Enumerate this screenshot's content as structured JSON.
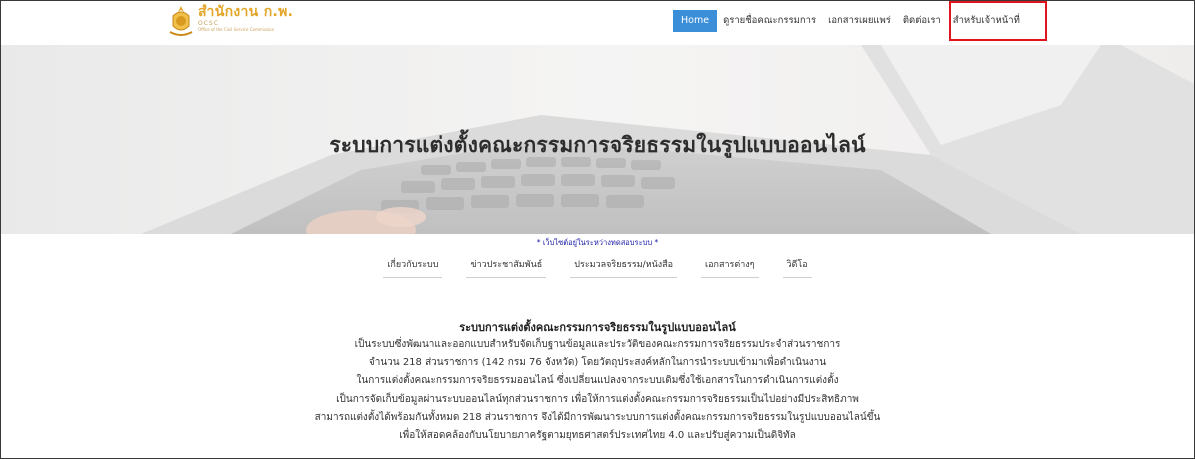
{
  "logo": {
    "name": "สำนักงาน ก.พ.",
    "abbr": "OCSC",
    "org": "Office of the Civil Service Commission"
  },
  "nav": {
    "items": [
      {
        "label": "Home",
        "active": true
      },
      {
        "label": "ดูรายชื่อคณะกรรมการ",
        "active": false
      },
      {
        "label": "เอกสารเผยแพร่",
        "active": false
      },
      {
        "label": "ติดต่อเรา",
        "active": false
      },
      {
        "label": "สำหรับเจ้าหน้าที่",
        "active": false
      }
    ]
  },
  "hero": {
    "title": "ระบบการแต่งตั้งคณะกรรมการจริยธรรมในรูปแบบออนไลน์"
  },
  "notice": "* เว็บไซต์อยู่ในระหว่างทดสอบระบบ *",
  "subnav": {
    "items": [
      {
        "label": "เกี่ยวกับระบบ"
      },
      {
        "label": "ข่าวประชาสัมพันธ์"
      },
      {
        "label": "ประมวลจริยธรรม/หนังสือ"
      },
      {
        "label": "เอกสารต่างๆ"
      },
      {
        "label": "วิดีโอ"
      }
    ]
  },
  "content": {
    "title": "ระบบการแต่งตั้งคณะกรรมการจริยธรรมในรูปแบบออนไลน์",
    "lines": [
      "เป็นระบบซึ่งพัฒนาและออกแบบสำหรับจัดเก็บฐานข้อมูลและประวัติของคณะกรรมการจริยธรรมประจำส่วนราชการ",
      "จำนวน 218 ส่วนราชการ (142 กรม 76 จังหวัด) โดยวัตถุประสงค์หลักในการนำระบบเข้ามาเพื่อดำเนินงาน",
      "ในการแต่งตั้งคณะกรรมการจริยธรรมออนไลน์ ซึ่งเปลี่ยนแปลงจากระบบเดิมซึ่งใช้เอกสารในการดำเนินการแต่งตั้ง",
      "เป็นการจัดเก็บข้อมูลผ่านระบบออนไลน์ทุกส่วนราชการ เพื่อให้การแต่งตั้งคณะกรรมการจริยธรรมเป็นไปอย่างมีประสิทธิภาพ",
      "สามารถแต่งตั้งได้พร้อมกันทั้งหมด 218 ส่วนราชการ จึงได้มีการพัฒนาระบบการแต่งตั้งคณะกรรมการจริยธรรมในรูปแบบออนไลน์ขึ้น",
      "เพื่อให้สอดคล้องกับนโยบายภาครัฐตามยุทธศาสตร์ประเทศไทย 4.0 และปรับสู่ความเป็นดิจิทัล"
    ]
  },
  "colors": {
    "active_nav": "#3b8fd9",
    "highlight": "#e0141c",
    "notice": "#1a1aa6",
    "logo": "#e3a62a"
  }
}
